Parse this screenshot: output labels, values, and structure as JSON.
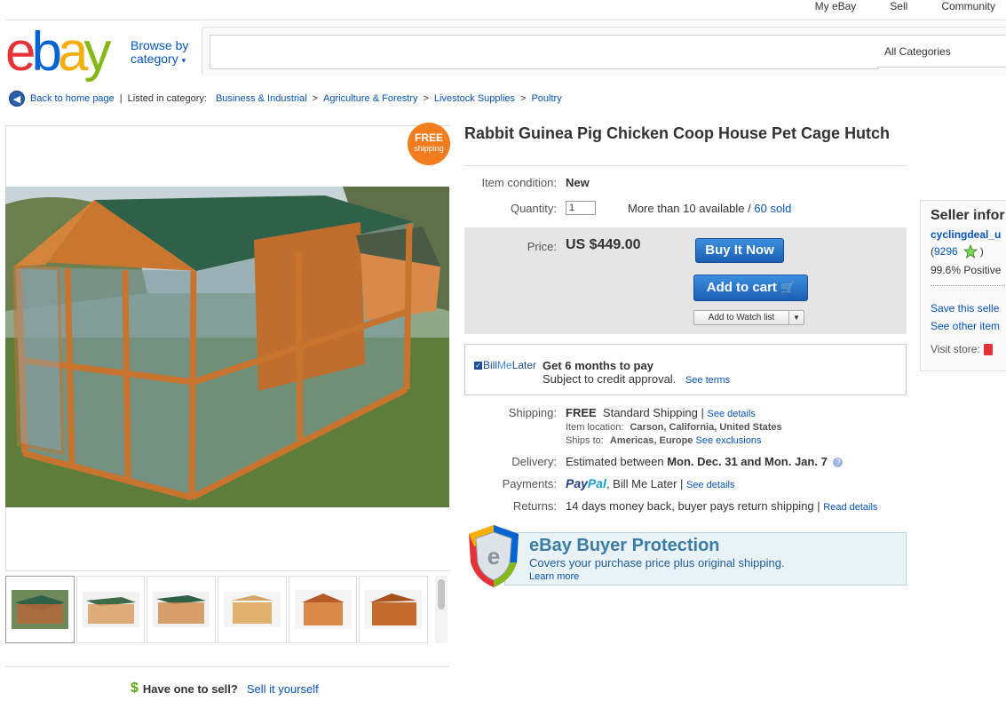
{
  "topnav": {
    "my_ebay": "My eBay",
    "sell": "Sell",
    "community": "Community"
  },
  "header": {
    "logo": {
      "e": "e",
      "b": "b",
      "a": "a",
      "y": "y"
    },
    "browse_line1": "Browse by",
    "browse_line2": "category",
    "search_placeholder": "",
    "category_select": "All Categories"
  },
  "breadcrumb": {
    "back": "Back to home page",
    "listed": "Listed in category:",
    "items": [
      "Business & Industrial",
      "Agriculture & Forestry",
      "Livestock Supplies",
      "Poultry"
    ]
  },
  "badge": {
    "line1": "FREE",
    "line2": "shipping"
  },
  "item": {
    "title": "Rabbit Guinea Pig Chicken Coop House Pet Cage Hutch",
    "condition_label": "Item condition:",
    "condition_value": "New",
    "quantity_label": "Quantity:",
    "quantity_value": "1",
    "availability": "More than 10 available /",
    "sold": "60 sold",
    "price_label": "Price:",
    "price": "US $449.00",
    "buy_now": "Buy It Now",
    "add_to_cart": "Add to cart",
    "watch_list": "Add to Watch list"
  },
  "billmelater": {
    "logo_bill": "Bill",
    "logo_me": "Me",
    "logo_later": "Later",
    "headline": "Get 6 months to pay",
    "sub": "Subject to credit approval.",
    "link": "See terms"
  },
  "shipping": {
    "label": "Shipping:",
    "free": "FREE",
    "method": "Standard Shipping |",
    "details_link": "See details",
    "location_label": "Item location:",
    "location": "Carson, California, United States",
    "ships_label": "Ships to:",
    "ships_to": "Americas, Europe",
    "exclusions_link": "See exclusions"
  },
  "delivery": {
    "label": "Delivery:",
    "prefix": "Estimated between",
    "range": "Mon. Dec. 31 and Mon. Jan. 7"
  },
  "payments": {
    "label": "Payments:",
    "paypal_1": "Pay",
    "paypal_2": "Pal",
    "others": ", Bill Me Later |",
    "details_link": "See details"
  },
  "returns": {
    "label": "Returns:",
    "text": "14 days money back, buyer pays return shipping |",
    "link": "Read details"
  },
  "protection": {
    "title": "eBay Buyer Protection",
    "sub": "Covers your purchase price plus original shipping.",
    "link": "Learn more"
  },
  "seller": {
    "heading": "Seller infor",
    "name": "cyclingdeal_u",
    "feedback_open": "(",
    "feedback": "9296",
    "feedback_close": ")",
    "positive": "99.6% Positive",
    "save": "Save this selle",
    "other": "See other item",
    "store": "Visit store:"
  },
  "sell": {
    "question": "Have one to sell?",
    "link": "Sell it yourself"
  },
  "colors": {
    "accent": "#0654ba",
    "button": "#1a5fb4",
    "badge": "#f27d1e"
  },
  "icons": [
    "back-arrow-icon",
    "dropdown-icon",
    "cart-icon",
    "help-icon",
    "star-icon",
    "store-icon",
    "shield-icon",
    "dollar-icon"
  ]
}
